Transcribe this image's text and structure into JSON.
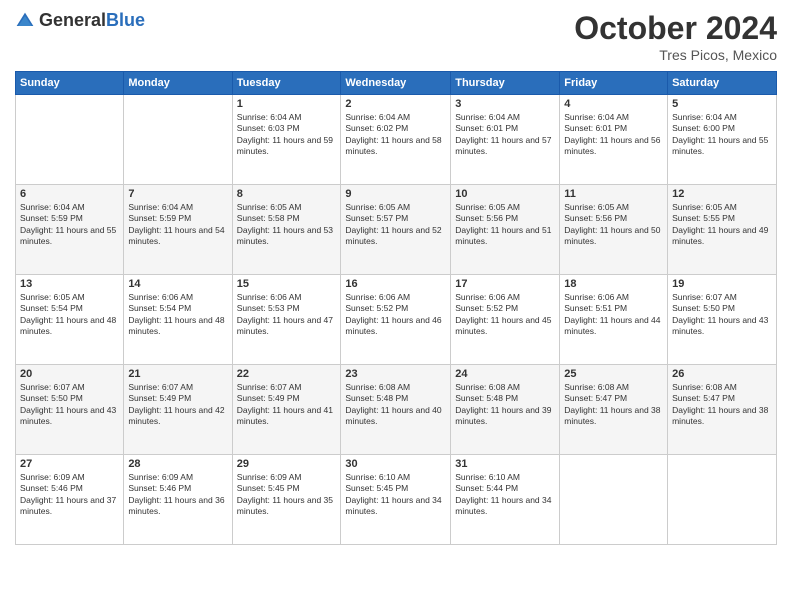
{
  "header": {
    "logo_general": "General",
    "logo_blue": "Blue",
    "month": "October 2024",
    "location": "Tres Picos, Mexico"
  },
  "days_of_week": [
    "Sunday",
    "Monday",
    "Tuesday",
    "Wednesday",
    "Thursday",
    "Friday",
    "Saturday"
  ],
  "weeks": [
    [
      {
        "day": "",
        "empty": true
      },
      {
        "day": "",
        "empty": true
      },
      {
        "day": "1",
        "sunrise": "Sunrise: 6:04 AM",
        "sunset": "Sunset: 6:03 PM",
        "daylight": "Daylight: 11 hours and 59 minutes."
      },
      {
        "day": "2",
        "sunrise": "Sunrise: 6:04 AM",
        "sunset": "Sunset: 6:02 PM",
        "daylight": "Daylight: 11 hours and 58 minutes."
      },
      {
        "day": "3",
        "sunrise": "Sunrise: 6:04 AM",
        "sunset": "Sunset: 6:01 PM",
        "daylight": "Daylight: 11 hours and 57 minutes."
      },
      {
        "day": "4",
        "sunrise": "Sunrise: 6:04 AM",
        "sunset": "Sunset: 6:01 PM",
        "daylight": "Daylight: 11 hours and 56 minutes."
      },
      {
        "day": "5",
        "sunrise": "Sunrise: 6:04 AM",
        "sunset": "Sunset: 6:00 PM",
        "daylight": "Daylight: 11 hours and 55 minutes."
      }
    ],
    [
      {
        "day": "6",
        "sunrise": "Sunrise: 6:04 AM",
        "sunset": "Sunset: 5:59 PM",
        "daylight": "Daylight: 11 hours and 55 minutes."
      },
      {
        "day": "7",
        "sunrise": "Sunrise: 6:04 AM",
        "sunset": "Sunset: 5:59 PM",
        "daylight": "Daylight: 11 hours and 54 minutes."
      },
      {
        "day": "8",
        "sunrise": "Sunrise: 6:05 AM",
        "sunset": "Sunset: 5:58 PM",
        "daylight": "Daylight: 11 hours and 53 minutes."
      },
      {
        "day": "9",
        "sunrise": "Sunrise: 6:05 AM",
        "sunset": "Sunset: 5:57 PM",
        "daylight": "Daylight: 11 hours and 52 minutes."
      },
      {
        "day": "10",
        "sunrise": "Sunrise: 6:05 AM",
        "sunset": "Sunset: 5:56 PM",
        "daylight": "Daylight: 11 hours and 51 minutes."
      },
      {
        "day": "11",
        "sunrise": "Sunrise: 6:05 AM",
        "sunset": "Sunset: 5:56 PM",
        "daylight": "Daylight: 11 hours and 50 minutes."
      },
      {
        "day": "12",
        "sunrise": "Sunrise: 6:05 AM",
        "sunset": "Sunset: 5:55 PM",
        "daylight": "Daylight: 11 hours and 49 minutes."
      }
    ],
    [
      {
        "day": "13",
        "sunrise": "Sunrise: 6:05 AM",
        "sunset": "Sunset: 5:54 PM",
        "daylight": "Daylight: 11 hours and 48 minutes."
      },
      {
        "day": "14",
        "sunrise": "Sunrise: 6:06 AM",
        "sunset": "Sunset: 5:54 PM",
        "daylight": "Daylight: 11 hours and 48 minutes."
      },
      {
        "day": "15",
        "sunrise": "Sunrise: 6:06 AM",
        "sunset": "Sunset: 5:53 PM",
        "daylight": "Daylight: 11 hours and 47 minutes."
      },
      {
        "day": "16",
        "sunrise": "Sunrise: 6:06 AM",
        "sunset": "Sunset: 5:52 PM",
        "daylight": "Daylight: 11 hours and 46 minutes."
      },
      {
        "day": "17",
        "sunrise": "Sunrise: 6:06 AM",
        "sunset": "Sunset: 5:52 PM",
        "daylight": "Daylight: 11 hours and 45 minutes."
      },
      {
        "day": "18",
        "sunrise": "Sunrise: 6:06 AM",
        "sunset": "Sunset: 5:51 PM",
        "daylight": "Daylight: 11 hours and 44 minutes."
      },
      {
        "day": "19",
        "sunrise": "Sunrise: 6:07 AM",
        "sunset": "Sunset: 5:50 PM",
        "daylight": "Daylight: 11 hours and 43 minutes."
      }
    ],
    [
      {
        "day": "20",
        "sunrise": "Sunrise: 6:07 AM",
        "sunset": "Sunset: 5:50 PM",
        "daylight": "Daylight: 11 hours and 43 minutes."
      },
      {
        "day": "21",
        "sunrise": "Sunrise: 6:07 AM",
        "sunset": "Sunset: 5:49 PM",
        "daylight": "Daylight: 11 hours and 42 minutes."
      },
      {
        "day": "22",
        "sunrise": "Sunrise: 6:07 AM",
        "sunset": "Sunset: 5:49 PM",
        "daylight": "Daylight: 11 hours and 41 minutes."
      },
      {
        "day": "23",
        "sunrise": "Sunrise: 6:08 AM",
        "sunset": "Sunset: 5:48 PM",
        "daylight": "Daylight: 11 hours and 40 minutes."
      },
      {
        "day": "24",
        "sunrise": "Sunrise: 6:08 AM",
        "sunset": "Sunset: 5:48 PM",
        "daylight": "Daylight: 11 hours and 39 minutes."
      },
      {
        "day": "25",
        "sunrise": "Sunrise: 6:08 AM",
        "sunset": "Sunset: 5:47 PM",
        "daylight": "Daylight: 11 hours and 38 minutes."
      },
      {
        "day": "26",
        "sunrise": "Sunrise: 6:08 AM",
        "sunset": "Sunset: 5:47 PM",
        "daylight": "Daylight: 11 hours and 38 minutes."
      }
    ],
    [
      {
        "day": "27",
        "sunrise": "Sunrise: 6:09 AM",
        "sunset": "Sunset: 5:46 PM",
        "daylight": "Daylight: 11 hours and 37 minutes."
      },
      {
        "day": "28",
        "sunrise": "Sunrise: 6:09 AM",
        "sunset": "Sunset: 5:46 PM",
        "daylight": "Daylight: 11 hours and 36 minutes."
      },
      {
        "day": "29",
        "sunrise": "Sunrise: 6:09 AM",
        "sunset": "Sunset: 5:45 PM",
        "daylight": "Daylight: 11 hours and 35 minutes."
      },
      {
        "day": "30",
        "sunrise": "Sunrise: 6:10 AM",
        "sunset": "Sunset: 5:45 PM",
        "daylight": "Daylight: 11 hours and 34 minutes."
      },
      {
        "day": "31",
        "sunrise": "Sunrise: 6:10 AM",
        "sunset": "Sunset: 5:44 PM",
        "daylight": "Daylight: 11 hours and 34 minutes."
      },
      {
        "day": "",
        "empty": true
      },
      {
        "day": "",
        "empty": true
      }
    ]
  ]
}
